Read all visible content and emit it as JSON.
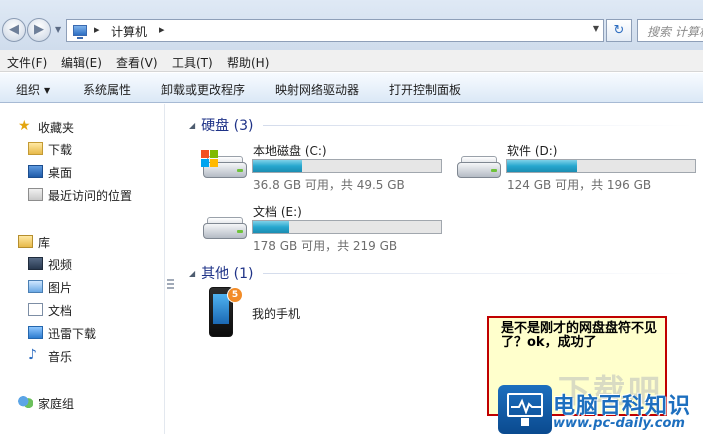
{
  "address_bar": {
    "location": "计算机",
    "search_placeholder": "搜索 计算机"
  },
  "menu": {
    "file": "文件(F)",
    "edit": "编辑(E)",
    "view": "查看(V)",
    "tools": "工具(T)",
    "help": "帮助(H)"
  },
  "toolbar": {
    "organize": "组织",
    "system_properties": "系统属性",
    "uninstall": "卸载或更改程序",
    "map_drive": "映射网络驱动器",
    "control_panel": "打开控制面板"
  },
  "nav": {
    "favorites": "收藏夹",
    "downloads": "下载",
    "desktop": "桌面",
    "recent": "最近访问的位置",
    "libraries": "库",
    "videos": "视频",
    "pictures": "图片",
    "documents": "文档",
    "xunlei": "迅雷下载",
    "music": "音乐",
    "homegroup": "家庭组"
  },
  "groups": {
    "hard_disks": "硬盘 (3)",
    "other": "其他 (1)"
  },
  "drives": [
    {
      "name": "本地磁盘 (C:)",
      "free_text": "36.8 GB 可用，共 49.5 GB",
      "used_fraction": 0.26
    },
    {
      "name": "软件 (D:)",
      "free_text": "124 GB 可用，共 196 GB",
      "used_fraction": 0.37
    },
    {
      "name": "文档 (E:)",
      "free_text": "178 GB 可用，共 219 GB",
      "used_fraction": 0.19
    }
  ],
  "other_device": {
    "name": "我的手机",
    "badge": "5"
  },
  "annotation": {
    "text": "是不是刚才的网盘盘符不见了？ok，成功了"
  },
  "watermark": {
    "title": "电脑百科知识",
    "url": "www.pc-daily.com",
    "ghost_text": "下载吧"
  },
  "colors": {
    "accent": "#1e3287",
    "bar_fill": "#27a7cf",
    "note_border": "#c00000",
    "note_bg": "#ffffcc",
    "watermark": "#1d6fbf"
  }
}
